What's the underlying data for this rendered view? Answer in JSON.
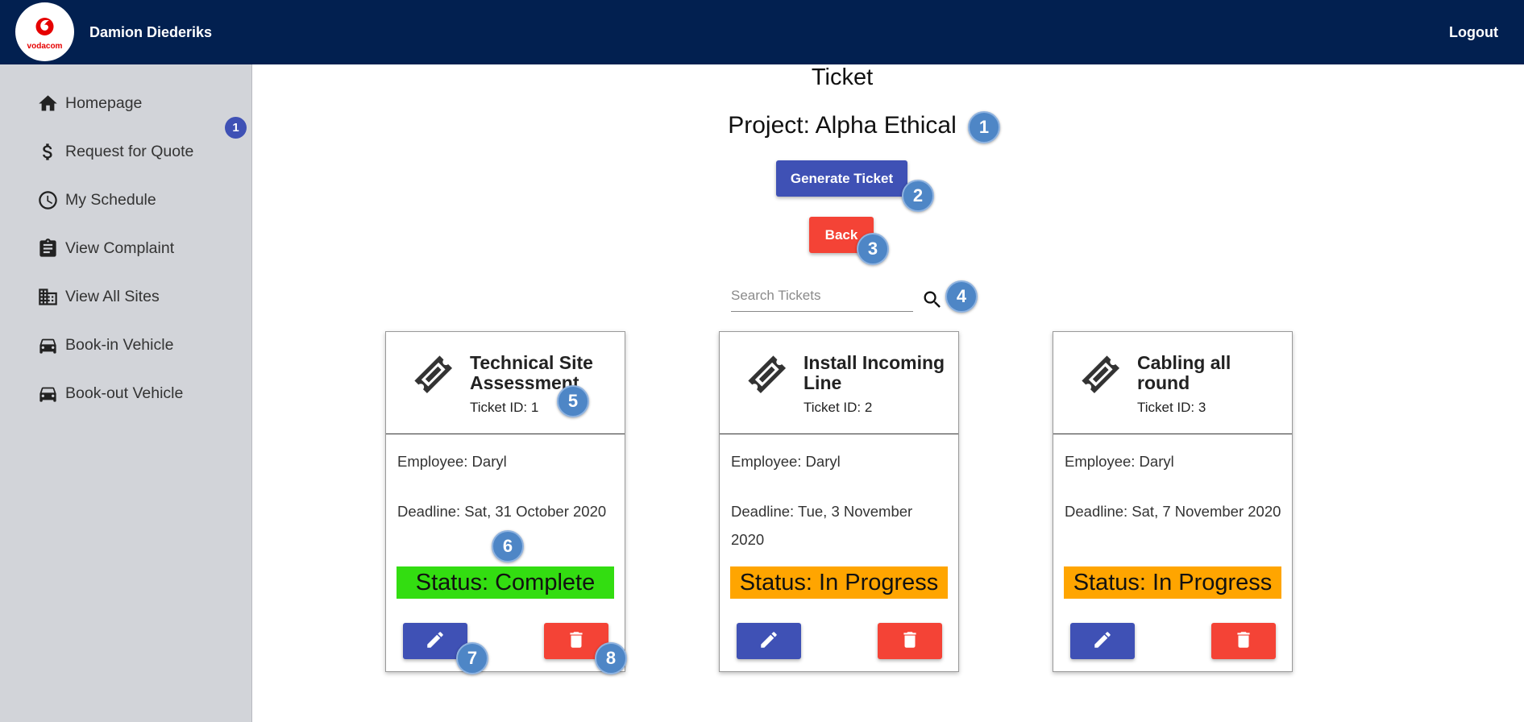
{
  "header": {
    "logo_text": "vodacom",
    "username": "Damion Diederiks",
    "logout_label": "Logout"
  },
  "sidebar": {
    "items": [
      {
        "label": "Homepage",
        "icon": "home-icon"
      },
      {
        "label": "Request for Quote",
        "icon": "dollar-icon"
      },
      {
        "label": "My Schedule",
        "icon": "clock-icon"
      },
      {
        "label": "View Complaint",
        "icon": "clipboard-icon"
      },
      {
        "label": "View All Sites",
        "icon": "building-icon"
      },
      {
        "label": "Book-in Vehicle",
        "icon": "car-icon"
      },
      {
        "label": "Book-out Vehicle",
        "icon": "car-icon"
      }
    ],
    "badge": "1"
  },
  "main": {
    "page_title": "Ticket",
    "project_title": "Project: Alpha Ethical",
    "generate_label": "Generate Ticket",
    "back_label": "Back",
    "search_placeholder": "Search Tickets"
  },
  "tickets": [
    {
      "title": "Technical Site Assessment",
      "id_label": "Ticket ID: 1",
      "employee": "Employee: Daryl",
      "deadline": "Deadline: Sat, 31 October 2020",
      "status": "Status: Complete",
      "status_color": "#33dd11"
    },
    {
      "title": "Install Incoming Line",
      "id_label": "Ticket ID: 2",
      "employee": "Employee: Daryl",
      "deadline": "Deadline: Tue, 3 November 2020",
      "status": "Status: In Progress",
      "status_color": "#ffa500"
    },
    {
      "title": "Cabling all round",
      "id_label": "Ticket ID: 3",
      "employee": "Employee: Daryl",
      "deadline": "Deadline: Sat, 7 November 2020",
      "status": "Status: In Progress",
      "status_color": "#ffa500"
    }
  ],
  "callouts": [
    "1",
    "2",
    "3",
    "4",
    "5",
    "6",
    "7",
    "8"
  ],
  "colors": {
    "header_bg": "#022050",
    "sidebar_bg": "#d2d4d9",
    "primary": "#3f51b5",
    "danger": "#f44336",
    "callout": "#4e86c6"
  }
}
